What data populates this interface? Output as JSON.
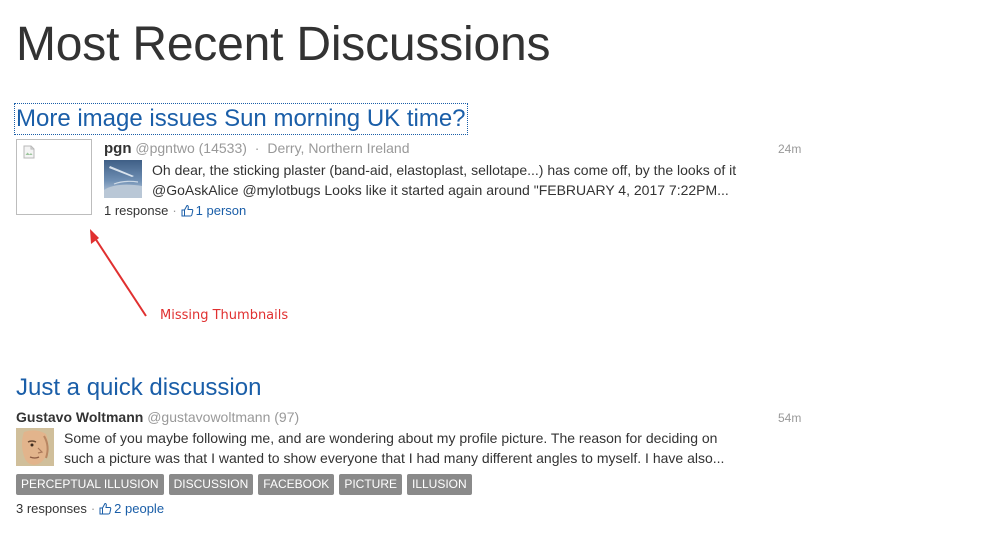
{
  "page": {
    "title": "Most Recent Discussions"
  },
  "discussions": [
    {
      "title": "More image issues Sun morning UK time?",
      "author": "pgn",
      "handle": "@pgntwo (14533)",
      "location": "Derry, Northern Ireland",
      "time": "24m",
      "excerpt_line1": "Oh dear, the sticking plaster (band-aid, elastoplast, sellotape...) has come off, by the looks of it",
      "excerpt_line2": "@GoAskAlice @mylotbugs Looks like it started again around \"FEBRUARY 4, 2017 7:22PM...",
      "responses": "1 response",
      "likes": "1 person"
    },
    {
      "title": "Just a quick discussion",
      "author": "Gustavo Woltmann",
      "handle": "@gustavowoltmann (97)",
      "time": "54m",
      "excerpt_line1": "Some of you maybe following me, and are wondering about my profile picture. The reason for deciding on",
      "excerpt_line2": "such a picture was that I wanted to show everyone that I had many different angles to myself. I have also...",
      "tags": [
        "PERCEPTUAL ILLUSION",
        "DISCUSSION",
        "FACEBOOK",
        "PICTURE",
        "ILLUSION"
      ],
      "responses": "3 responses",
      "likes": "2 people"
    }
  ],
  "annotation": {
    "label": "Missing Thumbnails",
    "color": "#e03030"
  },
  "icons": {
    "like": "thumbs-up-icon",
    "broken_image": "broken-image-icon"
  },
  "colors": {
    "link": "#1a5ea8",
    "tag_bg": "#8a8a8a",
    "muted": "#999999"
  }
}
